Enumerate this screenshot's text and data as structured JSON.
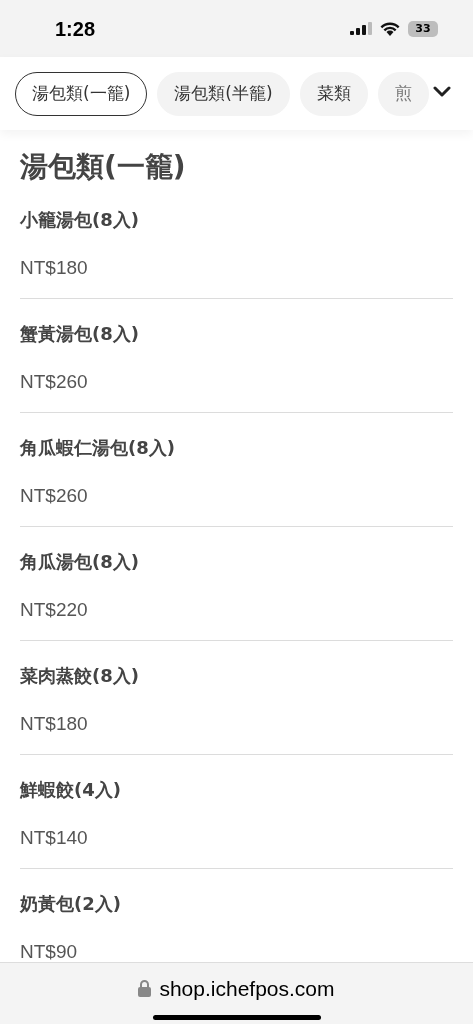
{
  "status_bar": {
    "time": "1:28",
    "battery": "33"
  },
  "tabs": [
    {
      "label": "湯包類(一籠)",
      "selected": true
    },
    {
      "label": "湯包類(半籠)",
      "selected": false
    },
    {
      "label": "菜類",
      "selected": false
    },
    {
      "label": "煎",
      "selected": false
    }
  ],
  "section": {
    "title": "湯包類(一籠)"
  },
  "items": [
    {
      "name": "小籠湯包(8入)",
      "price": "NT$180"
    },
    {
      "name": "蟹黃湯包(8入)",
      "price": "NT$260"
    },
    {
      "name": "角瓜蝦仁湯包(8入)",
      "price": "NT$260"
    },
    {
      "name": "角瓜湯包(8入)",
      "price": "NT$220"
    },
    {
      "name": "菜肉蒸餃(8入)",
      "price": "NT$180"
    },
    {
      "name": "鮮蝦餃(4入)",
      "price": "NT$140"
    },
    {
      "name": "奶黃包(2入)",
      "price": "NT$90"
    }
  ],
  "browser_bar": {
    "url": "shop.ichefpos.com"
  }
}
